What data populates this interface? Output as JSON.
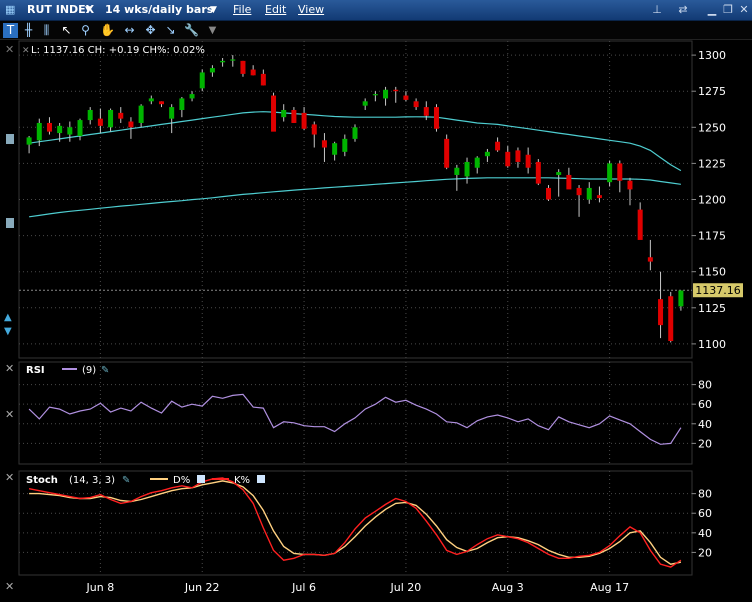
{
  "titlebar": {
    "symbol": "RUT INDEX",
    "period": "14 wks/daily bars",
    "menu_file": "File",
    "menu_edit": "Edit",
    "menu_view": "View"
  },
  "toolbar": {
    "icons": [
      "cursor-icon",
      "bar-chart-icon",
      "pointer-icon",
      "zoom-icon",
      "pan-icon",
      "split-icon",
      "crosshair-icon",
      "wrench-icon",
      "draw-icon",
      "dropdown-icon"
    ]
  },
  "readout": {
    "text": "L: 1137.16 CH: +0.19 CH%: 0.02%"
  },
  "panels": {
    "rsi_label": "RSI",
    "rsi_params": "(9)",
    "stoch_label": "Stoch",
    "stoch_params": "(14, 3, 3)",
    "stoch_d_label": "D%",
    "stoch_k_label": "K%"
  },
  "colors": {
    "background": "#000000",
    "grid": "#4a4a4a",
    "up_candle": "#00b400",
    "down_candle": "#e00000",
    "moving_average": "#4ecdd0",
    "rsi": "#b090e0",
    "stoch_k": "#ff2020",
    "stoch_d": "#ffd080",
    "last_price_badge": "#d6c96a"
  },
  "chart_data": [
    {
      "type": "candlestick",
      "title": "RUT INDEX",
      "x_ticks": [
        "Jun 8",
        "Jun 22",
        "Jul 6",
        "Jul 20",
        "Aug 3",
        "Aug 17"
      ],
      "x_tick_index": [
        7,
        17,
        27,
        37,
        47,
        57
      ],
      "y_ticks": [
        1100,
        1125,
        1150,
        1175,
        1200,
        1225,
        1250,
        1275,
        1300
      ],
      "ylim": [
        1093,
        1307
      ],
      "last_price": 1137.16,
      "ohlc": [
        [
          1238,
          1244,
          1232,
          1243
        ],
        [
          1241,
          1256,
          1237,
          1253
        ],
        [
          1253,
          1257,
          1245,
          1247
        ],
        [
          1246,
          1253,
          1240,
          1251
        ],
        [
          1245,
          1254,
          1240,
          1250
        ],
        [
          1244,
          1256,
          1241,
          1255
        ],
        [
          1255,
          1264,
          1252,
          1262
        ],
        [
          1256,
          1263,
          1246,
          1251
        ],
        [
          1250,
          1263,
          1247,
          1262
        ],
        [
          1260,
          1264,
          1253,
          1256
        ],
        [
          1254,
          1257,
          1242,
          1250
        ],
        [
          1253,
          1266,
          1250,
          1265
        ],
        [
          1268,
          1272,
          1266,
          1270
        ],
        [
          1268,
          1268,
          1264,
          1266
        ],
        [
          1256,
          1266,
          1246,
          1264
        ],
        [
          1262,
          1271,
          1257,
          1270
        ],
        [
          1270,
          1275,
          1268,
          1273
        ],
        [
          1277,
          1290,
          1275,
          1288
        ],
        [
          1288,
          1293,
          1285,
          1291
        ],
        [
          1295,
          1298,
          1292,
          1296
        ],
        [
          1297,
          1300,
          1292,
          1297
        ],
        [
          1296,
          1296,
          1285,
          1287
        ],
        [
          1290,
          1293,
          1286,
          1286
        ],
        [
          1287,
          1290,
          1279,
          1279
        ],
        [
          1272,
          1274,
          1248,
          1247
        ],
        [
          1257,
          1266,
          1254,
          1262
        ],
        [
          1262,
          1264,
          1253,
          1253
        ],
        [
          1260,
          1264,
          1248,
          1249
        ],
        [
          1252,
          1254,
          1236,
          1245
        ],
        [
          1241,
          1246,
          1226,
          1236
        ],
        [
          1231,
          1240,
          1227,
          1239
        ],
        [
          1233,
          1245,
          1230,
          1242
        ],
        [
          1242,
          1252,
          1240,
          1250
        ],
        [
          1265,
          1270,
          1262,
          1268
        ],
        [
          1273,
          1275,
          1268,
          1273
        ],
        [
          1270,
          1278,
          1265,
          1276
        ],
        [
          1276,
          1278,
          1267,
          1275
        ],
        [
          1272,
          1275,
          1268,
          1269
        ],
        [
          1268,
          1270,
          1262,
          1264
        ],
        [
          1264,
          1268,
          1255,
          1258
        ],
        [
          1264,
          1266,
          1247,
          1249
        ],
        [
          1242,
          1245,
          1221,
          1222
        ],
        [
          1217,
          1224,
          1206,
          1222
        ],
        [
          1216,
          1229,
          1211,
          1226
        ],
        [
          1222,
          1230,
          1218,
          1229
        ],
        [
          1230,
          1235,
          1226,
          1233
        ],
        [
          1240,
          1243,
          1233,
          1234
        ],
        [
          1233,
          1237,
          1222,
          1223
        ],
        [
          1234,
          1236,
          1222,
          1226
        ],
        [
          1231,
          1236,
          1218,
          1222
        ],
        [
          1226,
          1228,
          1210,
          1211
        ],
        [
          1208,
          1210,
          1199,
          1200
        ],
        [
          1217,
          1221,
          1202,
          1219
        ],
        [
          1217,
          1222,
          1208,
          1207
        ],
        [
          1208,
          1210,
          1188,
          1203
        ],
        [
          1200,
          1212,
          1197,
          1208
        ],
        [
          1203,
          1209,
          1198,
          1201
        ],
        [
          1212,
          1227,
          1209,
          1225
        ],
        [
          1225,
          1227,
          1205,
          1213
        ],
        [
          1213,
          1215,
          1196,
          1207
        ],
        [
          1193,
          1198,
          1173,
          1172
        ],
        [
          1160,
          1172,
          1151,
          1157
        ],
        [
          1131,
          1150,
          1104,
          1113
        ],
        [
          1133,
          1136,
          1101,
          1102
        ],
        [
          1126,
          1136,
          1123,
          1137
        ]
      ],
      "moving_averages": [
        {
          "name": "short",
          "values": [
            1239,
            1240,
            1241,
            1242,
            1243,
            1244,
            1245,
            1246,
            1247,
            1248,
            1249,
            1250,
            1251,
            1252,
            1253,
            1254,
            1255,
            1256,
            1257,
            1258,
            1259,
            1260,
            1260.5,
            1260.8,
            1260.5,
            1260,
            1259.5,
            1259,
            1258.5,
            1258,
            1257.5,
            1257.2,
            1257,
            1257,
            1257,
            1257,
            1257,
            1257.2,
            1257.3,
            1257.2,
            1257,
            1256,
            1255,
            1254,
            1253,
            1252.5,
            1252,
            1251,
            1250,
            1249,
            1248,
            1247,
            1246,
            1245,
            1244,
            1243,
            1242,
            1241,
            1240,
            1239,
            1237,
            1234,
            1229,
            1224,
            1220
          ]
        },
        {
          "name": "long",
          "values": [
            1188,
            1189,
            1190,
            1191,
            1191.8,
            1192.5,
            1193.2,
            1194,
            1194.7,
            1195.4,
            1196,
            1196.7,
            1197.3,
            1198,
            1198.6,
            1199.2,
            1199.9,
            1200.5,
            1201.2,
            1202,
            1202.8,
            1203.5,
            1204.1,
            1204.7,
            1205.3,
            1205.9,
            1206.5,
            1207,
            1207.5,
            1208,
            1208.5,
            1209,
            1209.5,
            1210,
            1210.5,
            1211,
            1211.5,
            1212,
            1212.5,
            1213,
            1213.5,
            1214,
            1214.3,
            1214.6,
            1214.8,
            1215,
            1215,
            1215,
            1215,
            1215,
            1215,
            1215,
            1214.8,
            1214.6,
            1214.4,
            1214.2,
            1214.2,
            1214.2,
            1214.2,
            1214.2,
            1214,
            1213.5,
            1212.5,
            1211.5,
            1210.5
          ]
        }
      ]
    },
    {
      "type": "line",
      "title": "RSI",
      "y_ticks": [
        20,
        40,
        60,
        80
      ],
      "ylim": [
        2,
        100
      ],
      "series": [
        {
          "name": "RSI",
          "values": [
            55,
            45,
            57,
            55,
            50,
            53,
            55,
            61,
            52,
            56,
            53,
            62,
            56,
            51,
            63,
            57,
            60,
            58,
            68,
            66,
            69,
            70,
            57,
            56,
            36,
            42,
            41,
            38,
            37,
            37,
            32,
            40,
            46,
            55,
            60,
            67,
            62,
            64,
            59,
            55,
            50,
            42,
            41,
            36,
            43,
            47,
            49,
            46,
            42,
            45,
            38,
            34,
            47,
            42,
            39,
            36,
            40,
            48,
            44,
            40,
            32,
            24,
            19,
            20,
            36
          ]
        }
      ]
    },
    {
      "type": "line",
      "title": "Stoch",
      "y_ticks": [
        20,
        40,
        60,
        80
      ],
      "ylim": [
        0,
        98
      ],
      "series": [
        {
          "name": "K%",
          "values": [
            85,
            83,
            81,
            79,
            77,
            75,
            76,
            79,
            74,
            70,
            72,
            77,
            81,
            83,
            86,
            88,
            86,
            92,
            95,
            96,
            92,
            84,
            70,
            45,
            22,
            12,
            14,
            18,
            18,
            17,
            19,
            30,
            44,
            55,
            62,
            69,
            75,
            72,
            65,
            52,
            38,
            22,
            18,
            21,
            28,
            34,
            38,
            36,
            34,
            30,
            24,
            18,
            14,
            14,
            16,
            17,
            20,
            27,
            37,
            46,
            40,
            22,
            8,
            5,
            12
          ]
        },
        {
          "name": "D%",
          "values": [
            80,
            80,
            79,
            78,
            76,
            75,
            75,
            77,
            76,
            73,
            72,
            74,
            77,
            80,
            83,
            85,
            86,
            89,
            91,
            93,
            91,
            87,
            78,
            63,
            42,
            26,
            19,
            18,
            18,
            17,
            19,
            26,
            36,
            47,
            56,
            64,
            70,
            71,
            68,
            59,
            47,
            33,
            25,
            21,
            24,
            30,
            35,
            36,
            35,
            32,
            28,
            22,
            18,
            15,
            15,
            16,
            19,
            24,
            31,
            40,
            42,
            30,
            15,
            8,
            10
          ]
        }
      ]
    }
  ]
}
